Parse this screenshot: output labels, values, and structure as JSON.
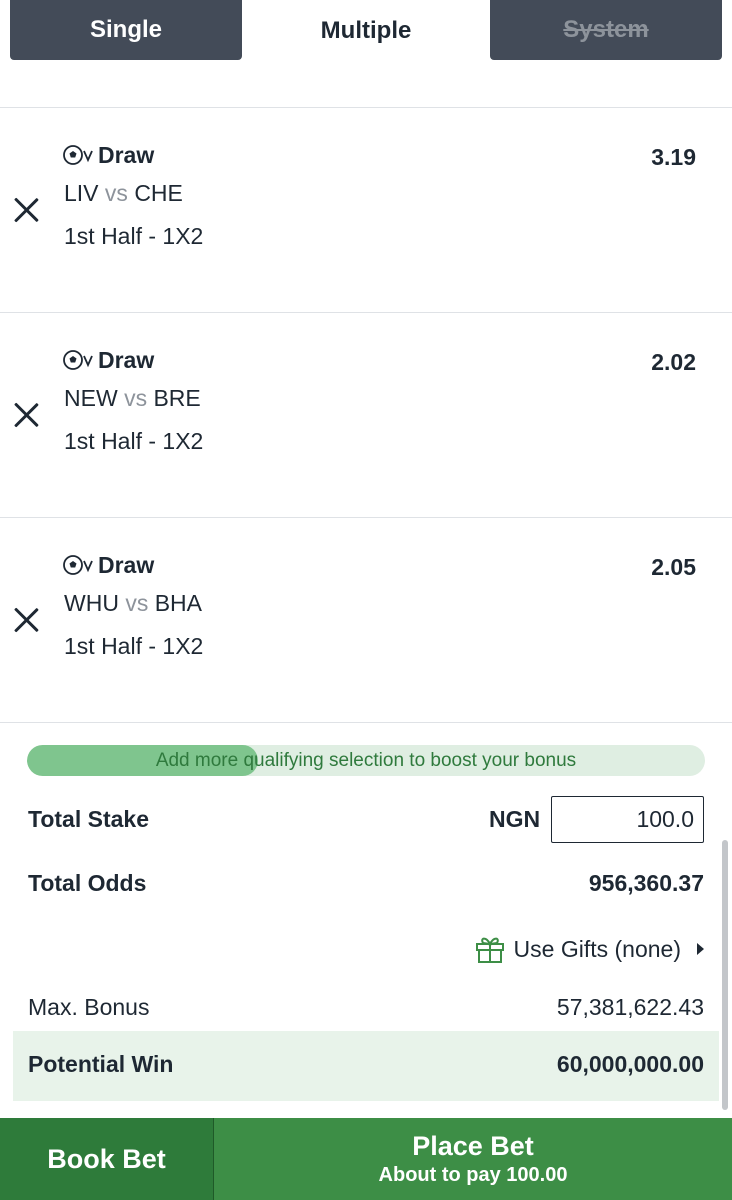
{
  "tabs": [
    {
      "label": "Single",
      "state": "inactive"
    },
    {
      "label": "Multiple",
      "state": "active"
    },
    {
      "label": "System",
      "state": "disabled"
    }
  ],
  "selections": [
    {
      "pick": "Draw",
      "home": "LIV",
      "vs": "vs",
      "away": "CHE",
      "market": "1st Half - 1X2",
      "odds": "3.19"
    },
    {
      "pick": "Draw",
      "home": "NEW",
      "vs": "vs",
      "away": "BRE",
      "market": "1st Half - 1X2",
      "odds": "2.02"
    },
    {
      "pick": "Draw",
      "home": "WHU",
      "vs": "vs",
      "away": "BHA",
      "market": "1st Half - 1X2",
      "odds": "2.05"
    }
  ],
  "bonus_bar": {
    "text": "Add more qualifying selection to boost your bonus",
    "progress": 0.34
  },
  "summary": {
    "total_stake_label": "Total Stake",
    "currency": "NGN",
    "stake_value": "100.0",
    "total_odds_label": "Total Odds",
    "total_odds_value": "956,360.37",
    "gifts_label": "Use Gifts (none)",
    "max_bonus_label": "Max. Bonus",
    "max_bonus_value": "57,381,622.43",
    "potential_win_label": "Potential Win",
    "potential_win_value": "60,000,000.00"
  },
  "footer": {
    "book_label": "Book Bet",
    "place_label": "Place Bet",
    "place_sub": "About to pay 100.00"
  },
  "colors": {
    "tab_dark": "#434b58",
    "green_primary": "#3d8e46",
    "green_dark": "#2e7b3a",
    "green_light": "#e8f3ea",
    "text": "#1e2833",
    "muted": "#8d939b"
  }
}
